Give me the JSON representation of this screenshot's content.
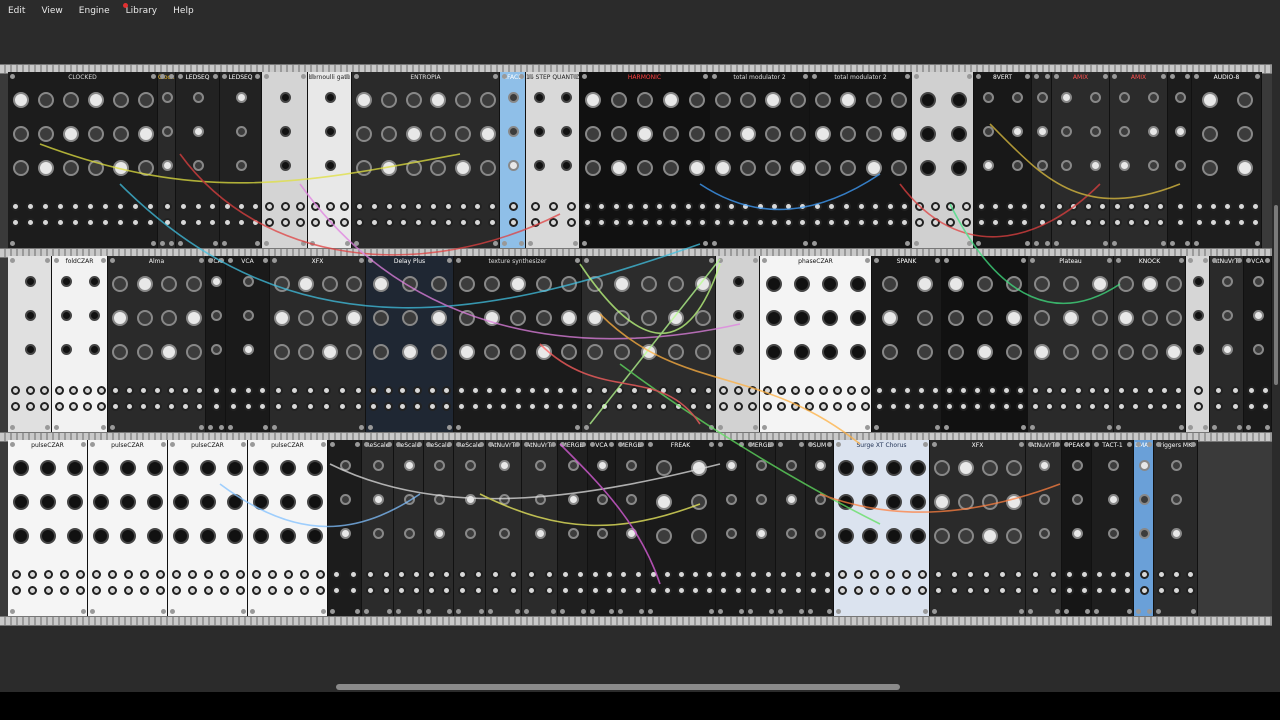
{
  "menubar": {
    "items": [
      "Edit",
      "View",
      "Engine",
      "Library",
      "Help"
    ]
  },
  "rack": {
    "row1": [
      {
        "name": "CLOCKED",
        "bg": "#1c1c1c",
        "fg": "#dddddd",
        "width": 150
      },
      {
        "name": "Clock Divider",
        "bg": "#2a2a2a",
        "fg": "#f0c030",
        "width": 18
      },
      {
        "name": "LEDSEQ",
        "bg": "#222222",
        "fg": "#ffffff",
        "width": 44
      },
      {
        "name": "LEDSEQ",
        "bg": "#222222",
        "fg": "#ffffff",
        "width": 42
      },
      {
        "name": "",
        "bg": "#d4d4d4",
        "fg": "#222222",
        "width": 46
      },
      {
        "name": "bernoulli gate",
        "bg": "#e8e8e8",
        "fg": "#222222",
        "width": 44
      },
      {
        "name": "ENTROPIA",
        "bg": "#2a2a2a",
        "fg": "#e0e0e0",
        "width": 148
      },
      {
        "name": "BFACE",
        "bg": "#8fbfe8",
        "fg": "#ffffff",
        "width": 26
      },
      {
        "name": "16 STEP QUANTIZER",
        "bg": "#d9d9d9",
        "fg": "#222222",
        "width": 54
      },
      {
        "name": "HARMONIC",
        "bg": "#111111",
        "fg": "#ff4040",
        "width": 130
      },
      {
        "name": "total modulator 2",
        "bg": "#151515",
        "fg": "#dddddd",
        "width": 100
      },
      {
        "name": "total modulator 2",
        "bg": "#151515",
        "fg": "#dddddd",
        "width": 102
      },
      {
        "name": "",
        "bg": "#d0d0d0",
        "fg": "#222222",
        "width": 62
      },
      {
        "name": "8VERT",
        "bg": "#181818",
        "fg": "#ffffff",
        "width": 58
      },
      {
        "name": "",
        "bg": "#262626",
        "fg": "#ffffff",
        "width": 20
      },
      {
        "name": "AMIX",
        "bg": "#2b2b2b",
        "fg": "#ff5050",
        "width": 58
      },
      {
        "name": "AMIX",
        "bg": "#2b2b2b",
        "fg": "#ff5050",
        "width": 58
      },
      {
        "name": "",
        "bg": "#1c1c1c",
        "fg": "#dddddd",
        "width": 24
      },
      {
        "name": "AUDIO-8",
        "bg": "#1d1d1d",
        "fg": "#ffffff",
        "width": 70
      }
    ],
    "row2": [
      {
        "name": "",
        "bg": "#e0e0e0",
        "fg": "#222222",
        "width": 44
      },
      {
        "name": "foldCZAR",
        "bg": "#f2f2f2",
        "fg": "#111111",
        "width": 56
      },
      {
        "name": "Alma",
        "bg": "#2a2a2a",
        "fg": "#f2f2f2",
        "width": 98
      },
      {
        "name": "VCA",
        "bg": "#1a1a1a",
        "fg": "#eeeeee",
        "width": 20
      },
      {
        "name": "VCA",
        "bg": "#1a1a1a",
        "fg": "#eeeeee",
        "width": 44
      },
      {
        "name": "XFX",
        "bg": "#2a2a2a",
        "fg": "#ffffff",
        "width": 96
      },
      {
        "name": "Delay Plus",
        "bg": "#1f2733",
        "fg": "#ffffff",
        "width": 88
      },
      {
        "name": "texture synthesizer",
        "bg": "#1b1b1b",
        "fg": "#dddddd",
        "width": 128
      },
      {
        "name": "",
        "bg": "#2c2c2c",
        "fg": "#dddddd",
        "width": 134
      },
      {
        "name": "",
        "bg": "#d2d2d2",
        "fg": "#222222",
        "width": 44
      },
      {
        "name": "phaseCZAR",
        "bg": "#f4f4f4",
        "fg": "#111111",
        "width": 112
      },
      {
        "name": "SPANK",
        "bg": "#1a1a1a",
        "fg": "#ffffff",
        "width": 70
      },
      {
        "name": "",
        "bg": "#111111",
        "fg": "#ff3060",
        "width": 86
      },
      {
        "name": "Plateau",
        "bg": "#2a2a2a",
        "fg": "#ffffff",
        "width": 86
      },
      {
        "name": "KNOCK",
        "bg": "#262626",
        "fg": "#ffffff",
        "width": 72
      },
      {
        "name": "",
        "bg": "#d6d6d6",
        "fg": "#222222",
        "width": 24
      },
      {
        "name": "AtNuVrTr",
        "bg": "#2a2a2a",
        "fg": "#ffffff",
        "width": 34
      },
      {
        "name": "VCA",
        "bg": "#1a1a1a",
        "fg": "#eeeeee",
        "width": 28
      }
    ],
    "row3": [
      {
        "name": "pulseCZAR",
        "bg": "#f5f5f5",
        "fg": "#111111",
        "width": 80
      },
      {
        "name": "pulseCZAR",
        "bg": "#f5f5f5",
        "fg": "#111111",
        "width": 80
      },
      {
        "name": "pulseCZAR",
        "bg": "#f5f5f5",
        "fg": "#111111",
        "width": 80
      },
      {
        "name": "pulseCZAR",
        "bg": "#f5f5f5",
        "fg": "#111111",
        "width": 80
      },
      {
        "name": "",
        "bg": "#1c1c1c",
        "fg": "#dddddd",
        "width": 34
      },
      {
        "name": "ReScale",
        "bg": "#2b2b2b",
        "fg": "#ffffff",
        "width": 32
      },
      {
        "name": "ReScale",
        "bg": "#2b2b2b",
        "fg": "#ffffff",
        "width": 30
      },
      {
        "name": "ReScale",
        "bg": "#2b2b2b",
        "fg": "#ffffff",
        "width": 30
      },
      {
        "name": "ReScale",
        "bg": "#2b2b2b",
        "fg": "#ffffff",
        "width": 32
      },
      {
        "name": "AtNuVrTr",
        "bg": "#2b2b2b",
        "fg": "#ffffff",
        "width": 36
      },
      {
        "name": "AtNuVrTr",
        "bg": "#2b2b2b",
        "fg": "#ffffff",
        "width": 36
      },
      {
        "name": "MERGE",
        "bg": "#1f1f1f",
        "fg": "#ffffff",
        "width": 30
      },
      {
        "name": "VCA",
        "bg": "#1b1b1b",
        "fg": "#ffffff",
        "width": 28
      },
      {
        "name": "MERGE",
        "bg": "#1f1f1f",
        "fg": "#ffffff",
        "width": 30
      },
      {
        "name": "FREAK",
        "bg": "#1a1a1a",
        "fg": "#ffffff",
        "width": 70
      },
      {
        "name": "",
        "bg": "#1b1b1b",
        "fg": "#ff4040",
        "width": 30
      },
      {
        "name": "MERGE",
        "bg": "#1f1f1f",
        "fg": "#ffffff",
        "width": 30
      },
      {
        "name": "",
        "bg": "#222222",
        "fg": "#ffffff",
        "width": 30
      },
      {
        "name": "SUM",
        "bg": "#1f1f1f",
        "fg": "#ffffff",
        "width": 28
      },
      {
        "name": "Surge XT Chorus",
        "bg": "#dbe3ef",
        "fg": "#223355",
        "width": 96
      },
      {
        "name": "XFX",
        "bg": "#2a2a2a",
        "fg": "#ffffff",
        "width": 96
      },
      {
        "name": "AtNuVrTr",
        "bg": "#2b2b2b",
        "fg": "#ffffff",
        "width": 36
      },
      {
        "name": "PEAK",
        "bg": "#161616",
        "fg": "#ffffff",
        "width": 30
      },
      {
        "name": "TACT-1",
        "bg": "#1e1e1e",
        "fg": "#ffffff",
        "width": 42
      },
      {
        "name": "bMAP",
        "bg": "#6aa0d8",
        "fg": "#ffffff",
        "width": 20
      },
      {
        "name": "Triggers MKI",
        "bg": "#2a2a2a",
        "fg": "#ffffff",
        "width": 44
      }
    ]
  },
  "colors": {
    "background": "#2b2b2b",
    "rail": "#c9c9c9",
    "rack": "#3a3a3a",
    "accent_red": "#e03030",
    "accent_green": "#7ae04a"
  }
}
